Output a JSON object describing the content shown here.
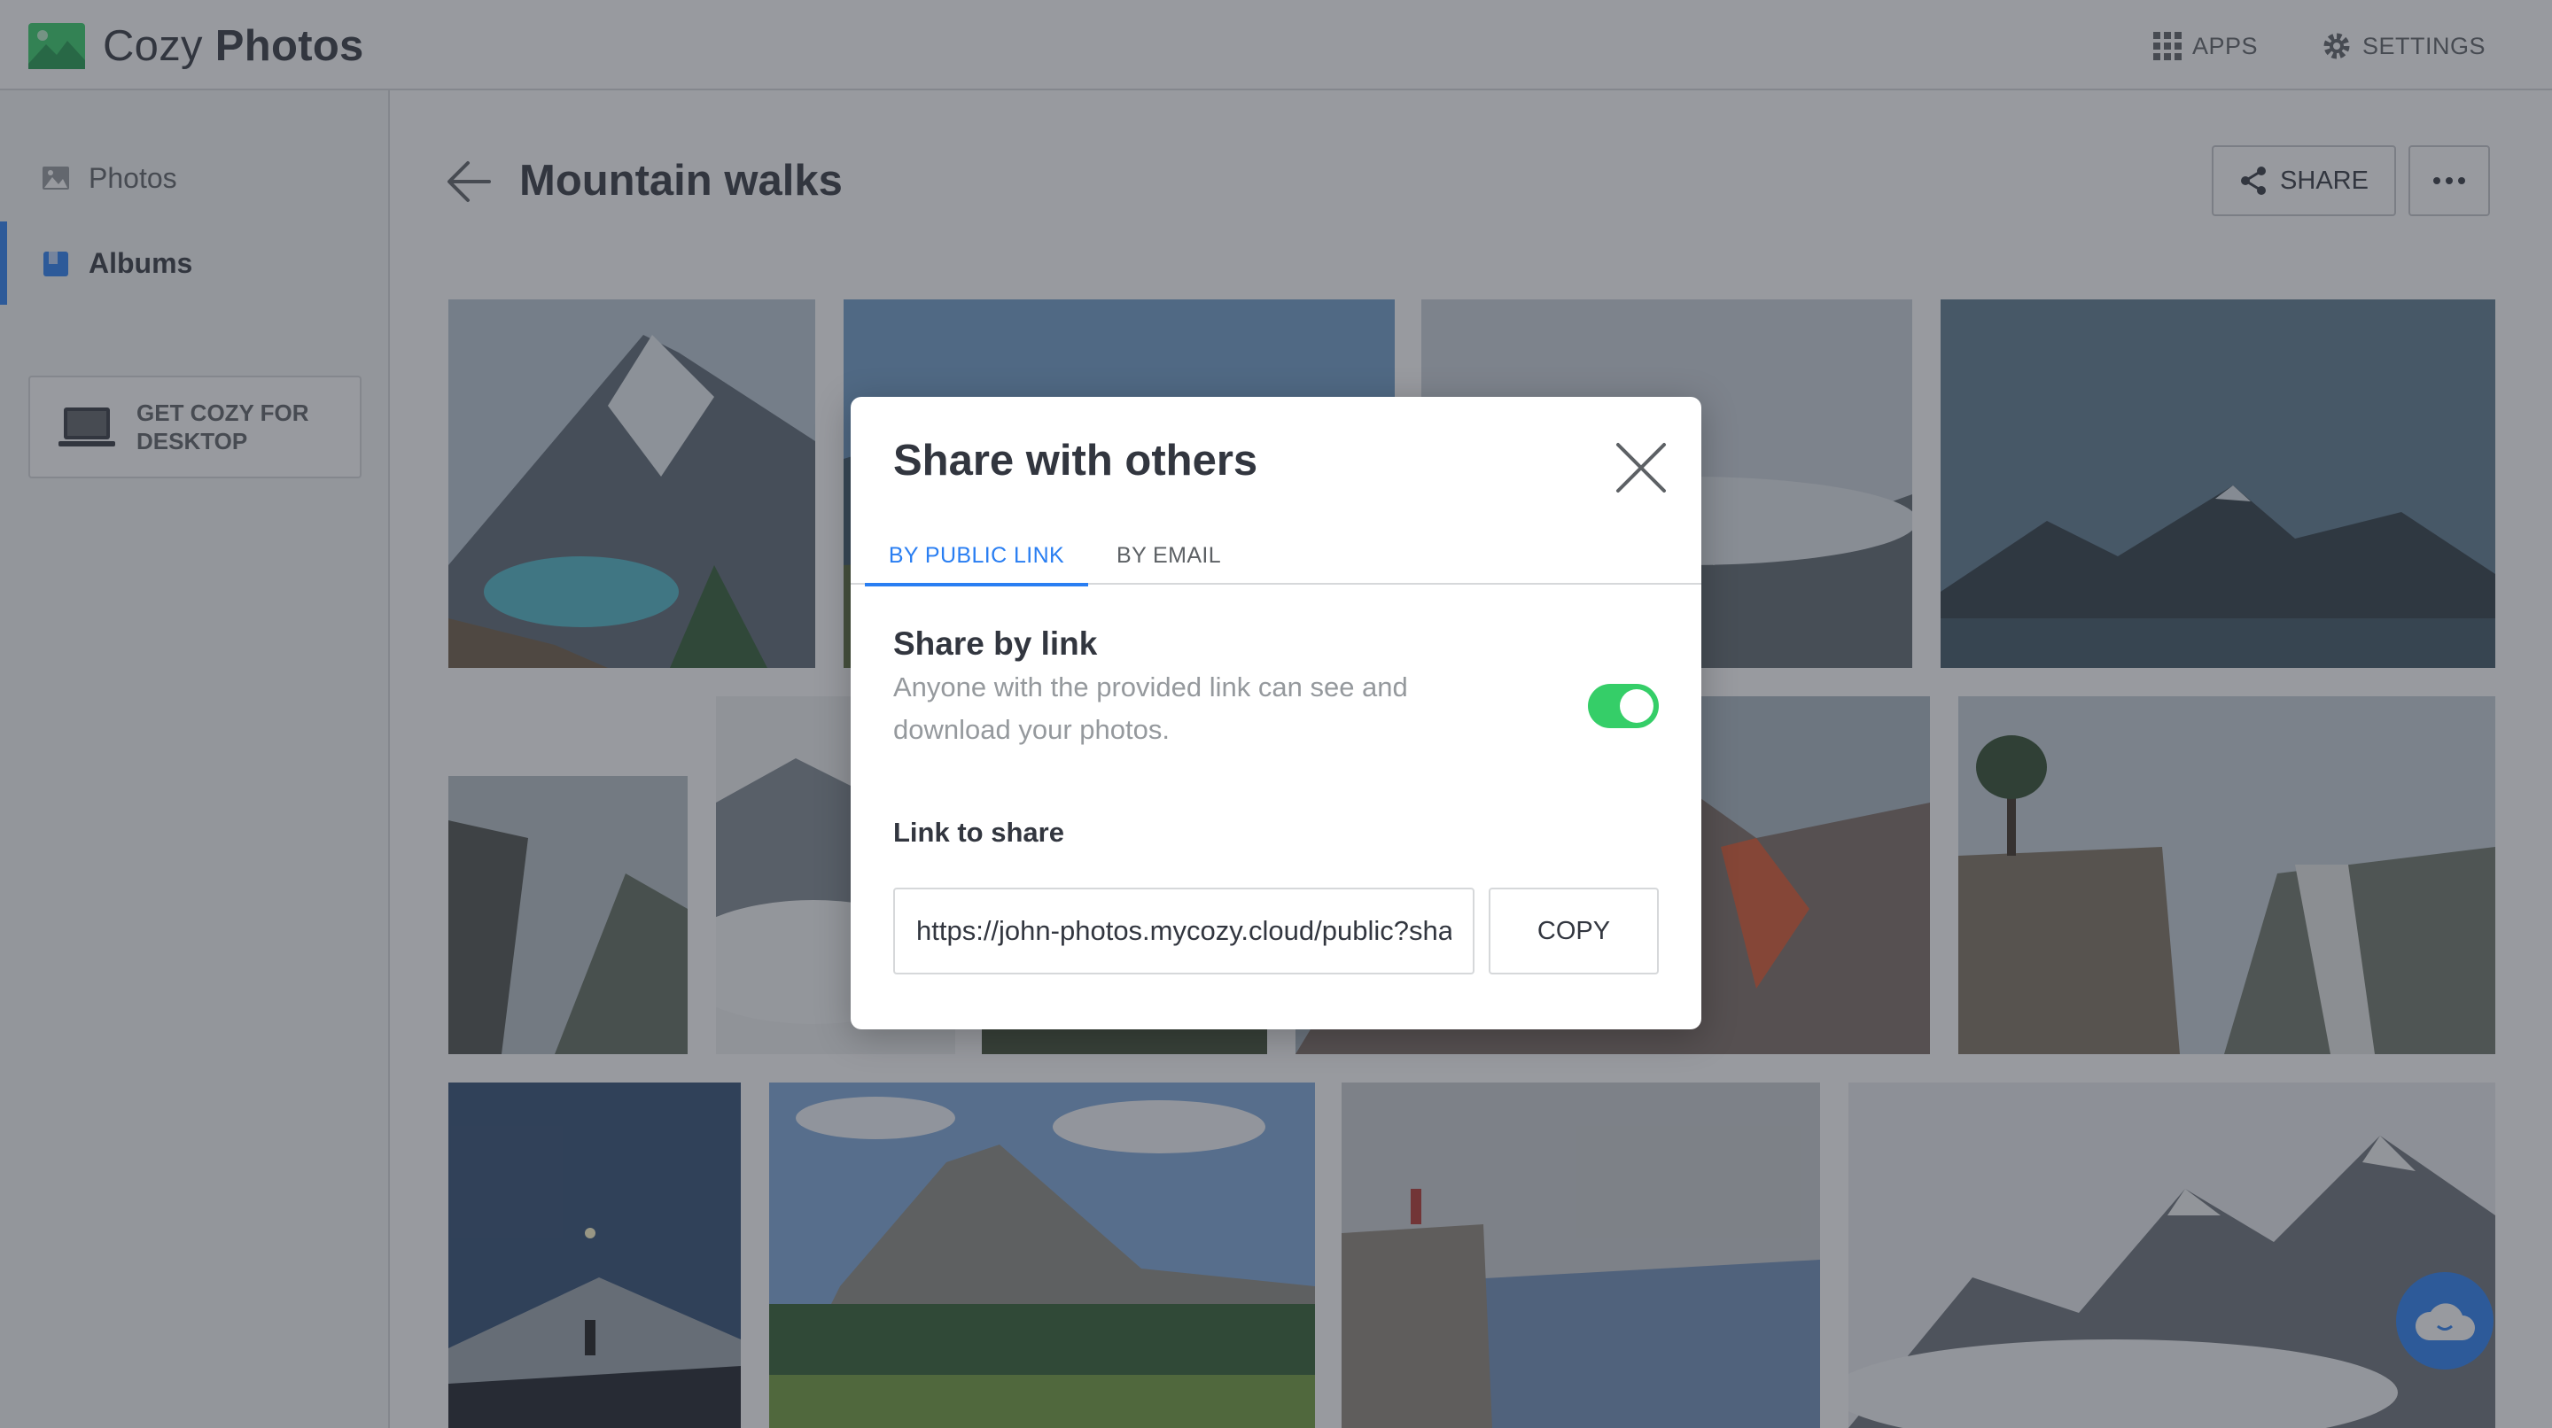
{
  "app": {
    "name_light": "Cozy",
    "name_bold": "Photos"
  },
  "top_nav": {
    "apps": "APPS",
    "settings": "SETTINGS"
  },
  "sidebar": {
    "items": [
      {
        "label": "Photos",
        "icon": "image-icon"
      },
      {
        "label": "Albums",
        "icon": "album-icon",
        "active": true
      }
    ],
    "desktop_cta": "GET COZY FOR DESKTOP"
  },
  "album": {
    "title": "Mountain walks",
    "share_label": "SHARE",
    "more_icon": "more-icon"
  },
  "photos": [
    "Alpine lake with hikers below a peak",
    "Blue sky over ridge",
    "Misty mountain valley",
    "Dark mountain peaks at dusk",
    "Climber on misty cliff",
    "Clouds among rocky peaks",
    "Valley with green slopes",
    "Red sunlit mountain ridges",
    "Lone tree on cliff edge",
    "Hiker facing moonlit peak",
    "Dolomite peak above forest meadow",
    "Person standing on rock outcrop",
    "Snowy peaks in clouds"
  ],
  "modal": {
    "title": "Share with others",
    "tabs": {
      "public_link": "BY PUBLIC LINK",
      "email": "BY EMAIL"
    },
    "share_by_link": {
      "title": "Share by link",
      "description": "Anyone with the provided link can see and download your photos.",
      "enabled": true
    },
    "link_label": "Link to share",
    "link_value": "https://john-photos.mycozy.cloud/public?sharecode=",
    "copy_label": "COPY"
  },
  "colors": {
    "accent": "#297ef2",
    "toggle_on": "#35ce68",
    "text": "#32363f",
    "muted": "#95999d"
  }
}
